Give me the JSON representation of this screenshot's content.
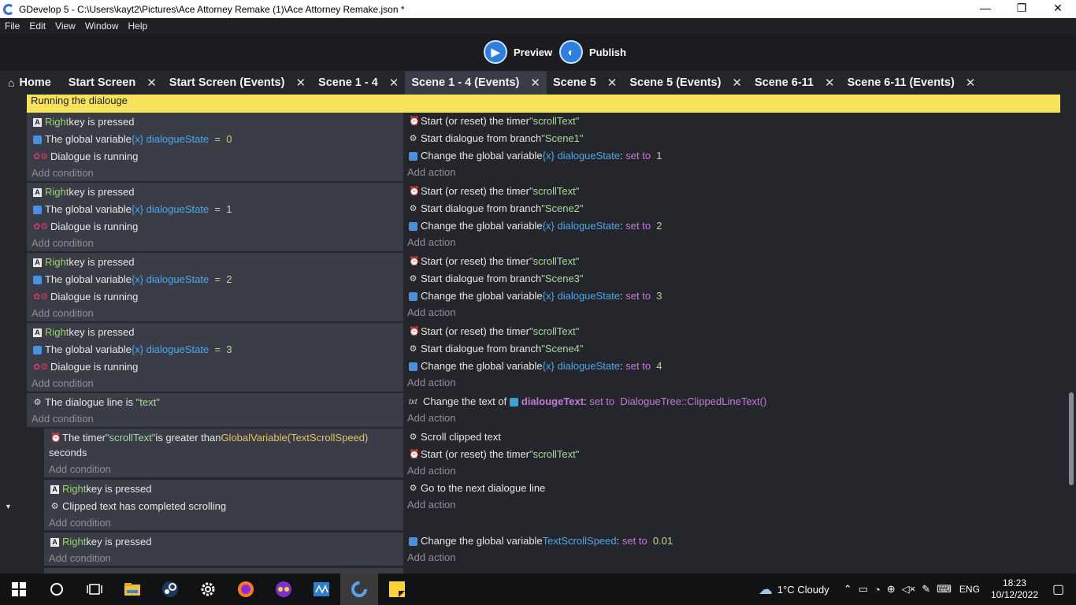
{
  "window": {
    "title": "GDevelop 5 - C:\\Users\\kayt2\\Pictures\\Ace Attorney Remake (1)\\Ace Attorney Remake.json *",
    "minimize": "—",
    "maximize": "❐",
    "close": "✕"
  },
  "menu": [
    "File",
    "Edit",
    "View",
    "Window",
    "Help"
  ],
  "toolbar": {
    "preview_label": "Preview",
    "publish_label": "Publish"
  },
  "tabs": [
    {
      "label": "Home",
      "closable": false
    },
    {
      "label": "Start Screen",
      "closable": true
    },
    {
      "label": "Start Screen (Events)",
      "closable": true
    },
    {
      "label": "Scene 1 - 4",
      "closable": true
    },
    {
      "label": "Scene 1 - 4 (Events)",
      "closable": true,
      "active": true
    },
    {
      "label": "Scene 5",
      "closable": true
    },
    {
      "label": "Scene 5 (Events)",
      "closable": true
    },
    {
      "label": "Scene 6-11",
      "closable": true
    },
    {
      "label": "Scene 6-11 (Events)",
      "closable": true
    }
  ],
  "tab_close_glyph": "✕",
  "comment": "Running the dialouge",
  "strings": {
    "add_condition": "Add condition",
    "add_action": "Add action",
    "right": "Right",
    "key_is_pressed": " key is pressed",
    "the_global_variable": "The global variable ",
    "dialogue_state": "dialogueState",
    "dialogue_running": "Dialogue is running",
    "start_reset_timer": "Start (or reset) the timer ",
    "scroll_text": "\"scrollText\"",
    "start_dialogue_branch": "Start dialogue from branch ",
    "change_global_variable": "Change the global variable ",
    "set_to": "set to",
    "eq": "=",
    "colon": ":"
  },
  "dialogue_events": [
    {
      "state": "0",
      "branch": "\"Scene1\"",
      "set": "1"
    },
    {
      "state": "1",
      "branch": "\"Scene2\"",
      "set": "2"
    },
    {
      "state": "2",
      "branch": "\"Scene3\"",
      "set": "3"
    },
    {
      "state": "3",
      "branch": "\"Scene4\"",
      "set": "4"
    }
  ],
  "text_event": {
    "cond": "The dialogue line is ",
    "cond_value": "\"text\"",
    "act": "Change the text of ",
    "object": "dialougeText",
    "expr": "DialogueTree::ClippedLineText()"
  },
  "sub_timer": {
    "cond_a": "The timer ",
    "timer": "\"scrollText\"",
    "cond_b": " is greater than ",
    "expr": "GlobalVariable(TextScrollSpeed)",
    "cond_c": "seconds",
    "act1": "Scroll clipped text",
    "act2": "Start (or reset) the timer "
  },
  "sub_next": {
    "cond2": "Clipped text has completed scrolling",
    "act": "Go to the next dialogue line"
  },
  "sub_speed": {
    "var": "TextScrollSpeed",
    "value": "0.01"
  },
  "taskbar": {
    "weather": "1°C  Cloudy",
    "lang": "ENG",
    "time": "18:23",
    "date": "10/12/2022"
  }
}
